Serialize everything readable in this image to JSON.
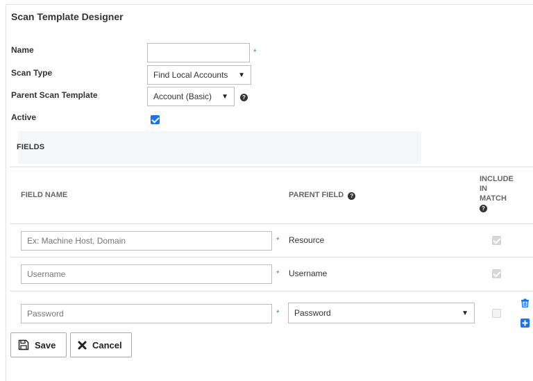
{
  "page": {
    "title": "Scan Template Designer"
  },
  "form": {
    "name_label": "Name",
    "name_value": "",
    "scan_type_label": "Scan Type",
    "scan_type_value": "Find Local Accounts",
    "parent_label": "Parent Scan Template",
    "parent_value": "Account (Basic)",
    "active_label": "Active",
    "active_checked": true,
    "required_mark": "*",
    "help_glyph": "?"
  },
  "fields_panel": {
    "title": "FIELDS"
  },
  "table": {
    "headers": {
      "field_name": "FIELD NAME",
      "parent_field": "PARENT FIELD",
      "include_line1": "INCLUDE",
      "include_line2": "IN",
      "include_line3": "MATCH"
    },
    "rows": [
      {
        "placeholder": "Ex: Machine Host, Domain",
        "parent": "Resource",
        "include": "checked-disabled"
      },
      {
        "placeholder": "Username",
        "parent": "Username",
        "include": "checked-disabled"
      },
      {
        "placeholder": "Password",
        "parent": "Password",
        "include": "unchecked-disabled"
      }
    ]
  },
  "actions": {
    "save_label": "Save",
    "cancel_label": "Cancel"
  },
  "colors": {
    "accent": "#1a73e8",
    "required": "#3b8fd9",
    "panel": "#f5f6f7"
  },
  "icons": [
    "help-icon",
    "chevron-down-icon",
    "trash-icon",
    "plus-square-icon",
    "save-icon",
    "close-icon"
  ]
}
